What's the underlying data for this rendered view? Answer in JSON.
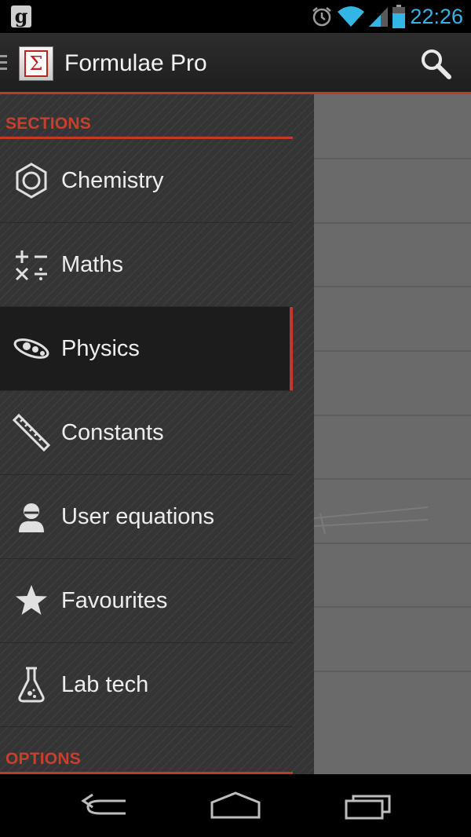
{
  "status_bar": {
    "time": "22:26",
    "left_icon_letter": "g",
    "accent_color": "#33b5e5"
  },
  "action_bar": {
    "title": "Formulae Pro",
    "app_icon_symbol": "Σ"
  },
  "drawer": {
    "sections_header": "SECTIONS",
    "options_header": "OPTIONS",
    "items": [
      {
        "label": "Chemistry",
        "icon": "hexagon-icon"
      },
      {
        "label": "Maths",
        "icon": "math-operators-icon"
      },
      {
        "label": "Physics",
        "icon": "orbit-icon",
        "active": true
      },
      {
        "label": "Constants",
        "icon": "ruler-icon"
      },
      {
        "label": "User equations",
        "icon": "user-icon"
      },
      {
        "label": "Favourites",
        "icon": "star-icon"
      },
      {
        "label": "Lab tech",
        "icon": "flask-icon"
      }
    ]
  },
  "colors": {
    "accent_red": "#c0392b",
    "drawer_bg": "#343434",
    "content_bg": "#6a6a6a"
  }
}
